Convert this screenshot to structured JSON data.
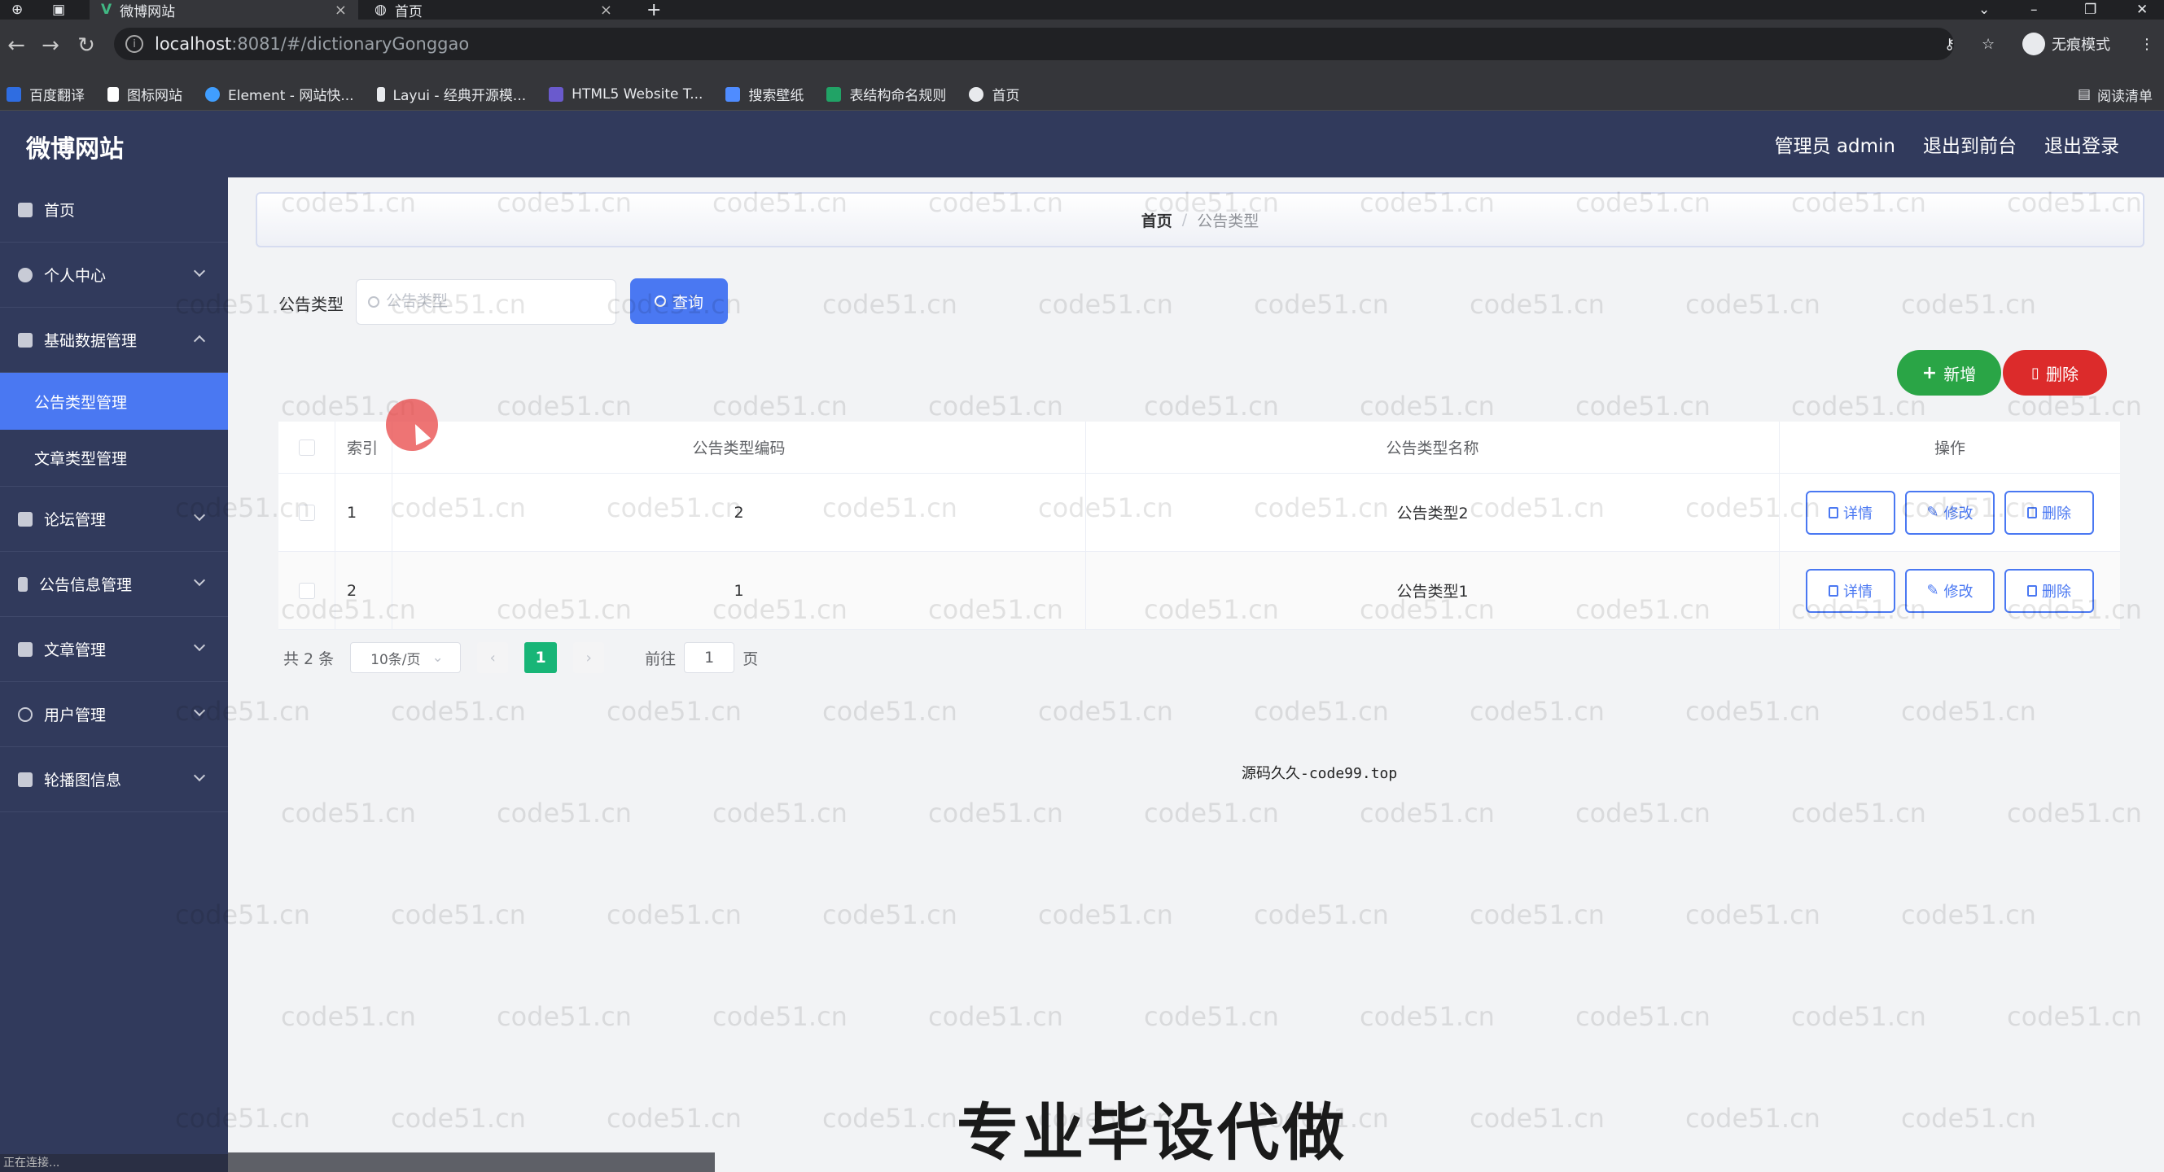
{
  "browser": {
    "tabs": [
      {
        "label": "微博网站",
        "active": true
      },
      {
        "label": "首页",
        "active": false
      }
    ],
    "url_host": "localhost",
    "url_rest": ":8081/#/dictionaryGonggao",
    "incognito_label": "无痕模式",
    "bookmarks": [
      "百度翻译",
      "图标网站",
      "Element - 网站快...",
      "Layui - 经典开源模...",
      "HTML5 Website T...",
      "搜索壁纸",
      "表结构命名规则",
      "首页"
    ],
    "reading_list": "阅读清单"
  },
  "header": {
    "title": "微博网站",
    "user": "管理员 admin",
    "to_front": "退出到前台",
    "logout": "退出登录"
  },
  "sidebar": {
    "items": [
      {
        "label": "首页",
        "icon": "home-icon"
      },
      {
        "label": "个人中心",
        "icon": "user-icon"
      },
      {
        "label": "基础数据管理",
        "icon": "data-icon"
      },
      {
        "label": "论坛管理",
        "icon": "forum-icon"
      },
      {
        "label": "公告信息管理",
        "icon": "notice-icon"
      },
      {
        "label": "文章管理",
        "icon": "article-icon"
      },
      {
        "label": "用户管理",
        "icon": "users-icon"
      },
      {
        "label": "轮播图信息",
        "icon": "carousel-icon"
      }
    ],
    "sub_items": [
      {
        "label": "公告类型管理",
        "active": true
      },
      {
        "label": "文章类型管理",
        "active": false
      }
    ]
  },
  "breadcrumb": {
    "home": "首页",
    "current": "公告类型"
  },
  "search": {
    "label": "公告类型",
    "placeholder": "公告类型",
    "button": "查询"
  },
  "actions": {
    "add": "新增",
    "delete": "删除"
  },
  "table": {
    "headers": [
      "索引",
      "公告类型编码",
      "公告类型名称",
      "操作"
    ],
    "rows": [
      {
        "index": "1",
        "code": "2",
        "name": "公告类型2"
      },
      {
        "index": "2",
        "code": "1",
        "name": "公告类型1"
      }
    ],
    "ops": {
      "detail": "详情",
      "edit": "修改",
      "delete": "删除"
    }
  },
  "pagination": {
    "total": "共 2 条",
    "page_size": "10条/页",
    "current_page": "1",
    "goto": "前往",
    "goto_value": "1",
    "page_suffix": "页"
  },
  "overlay": {
    "center_text": "源码久久-code99.top",
    "caption": "专业毕设代做",
    "watermark": "code51.cn",
    "status": "正在连接..."
  },
  "colors": {
    "primary": "#4a78f2",
    "success": "#2aa546",
    "danger": "#dc2b2b",
    "sidebar": "#313a5c",
    "pager_active": "#18b577"
  }
}
